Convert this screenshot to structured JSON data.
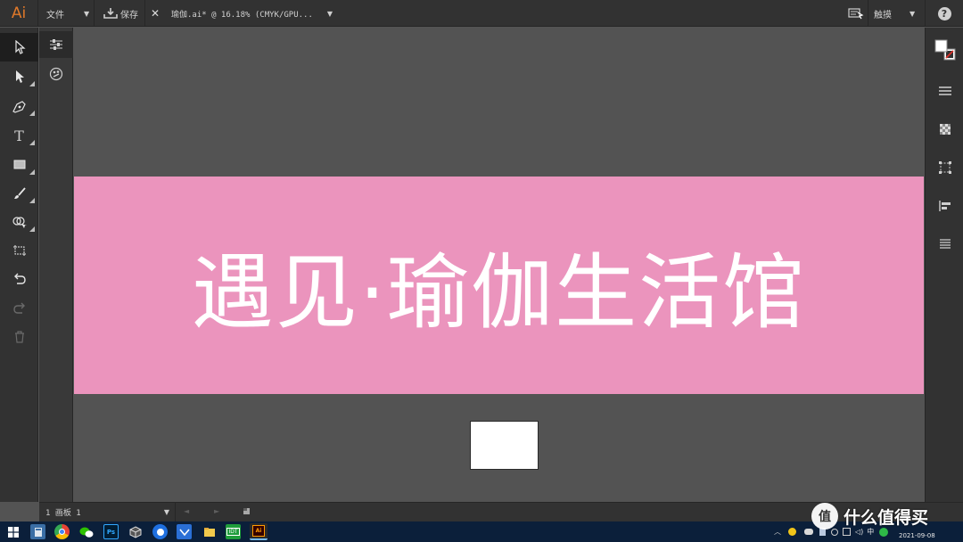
{
  "menubar": {
    "logo": "Ai",
    "file_menu": "文件",
    "save_label": "保存",
    "doc_title": "瑜伽.ai* @ 16.18% (CMYK/GPU...",
    "workspace_label": "触摸",
    "help": "?"
  },
  "artboard": {
    "text": "遇见·瑜伽生活馆",
    "background_color": "#eb94bd",
    "text_color": "#ffffff"
  },
  "statusbar": {
    "artboard_label": "1 画板 1"
  },
  "taskbar": {
    "date": "2021-09-08",
    "ime": "中",
    "watermark": "值 什么值得买"
  },
  "colors": {
    "accent_orange": "#e0792a",
    "ui_dark": "#323232",
    "canvas": "#535353",
    "artboard_pink": "#eb94bd"
  }
}
